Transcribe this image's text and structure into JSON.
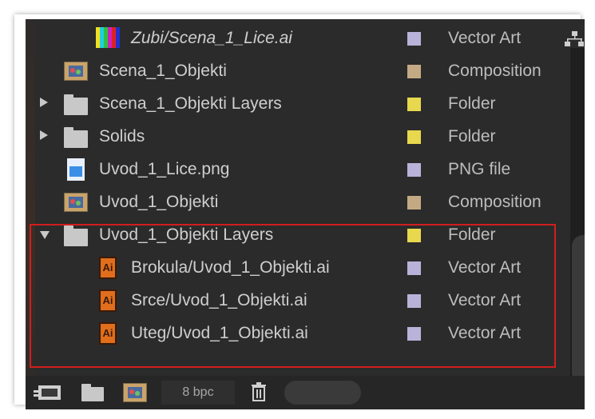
{
  "project_panel": {
    "rows": [
      {
        "name": "Zubi/Scena_1_Lice.ai",
        "type": "Vector Art",
        "swatch": "#b9b3d9",
        "icon": "color-bars-icon",
        "indent": 2,
        "italic": true,
        "toggle": ""
      },
      {
        "name": "Scena_1_Objekti",
        "type": "Composition",
        "swatch": "#c4aa84",
        "icon": "composition-icon",
        "indent": 1,
        "italic": false,
        "toggle": ""
      },
      {
        "name": "Scena_1_Objekti Layers",
        "type": "Folder",
        "swatch": "#e8d84e",
        "icon": "folder-icon",
        "indent": 1,
        "italic": false,
        "toggle": "collapsed"
      },
      {
        "name": "Solids",
        "type": "Folder",
        "swatch": "#e8d84e",
        "icon": "folder-icon",
        "indent": 1,
        "italic": false,
        "toggle": "collapsed"
      },
      {
        "name": "Uvod_1_Lice.png",
        "type": "PNG file",
        "swatch": "#b9b3d9",
        "icon": "png-file-icon",
        "indent": 1,
        "italic": false,
        "toggle": ""
      },
      {
        "name": "Uvod_1_Objekti",
        "type": "Composition",
        "swatch": "#c4aa84",
        "icon": "composition-icon",
        "indent": 1,
        "italic": false,
        "toggle": ""
      },
      {
        "name": "Uvod_1_Objekti Layers",
        "type": "Folder",
        "swatch": "#e8d84e",
        "icon": "folder-icon",
        "indent": 1,
        "italic": false,
        "toggle": "expanded"
      },
      {
        "name": "Brokula/Uvod_1_Objekti.ai",
        "type": "Vector Art",
        "swatch": "#b9b3d9",
        "icon": "illustrator-file-icon",
        "indent": 2,
        "italic": false,
        "toggle": ""
      },
      {
        "name": "Srce/Uvod_1_Objekti.ai",
        "type": "Vector Art",
        "swatch": "#b9b3d9",
        "icon": "illustrator-file-icon",
        "indent": 2,
        "italic": false,
        "toggle": ""
      },
      {
        "name": "Uteg/Uvod_1_Objekti.ai",
        "type": "Vector Art",
        "swatch": "#b9b3d9",
        "icon": "illustrator-file-icon",
        "indent": 2,
        "italic": false,
        "toggle": ""
      }
    ],
    "ai_icon_label": "Ai"
  },
  "bottom_bar": {
    "bit_depth": "8 bpc",
    "icons": [
      "interpret-footage-icon",
      "new-folder-icon",
      "new-composition-icon",
      "trash-icon"
    ]
  },
  "colors": {
    "panel_bg": "#2b2b2b",
    "highlight_border": "#d11e1e",
    "text": "#cfcfcf"
  }
}
